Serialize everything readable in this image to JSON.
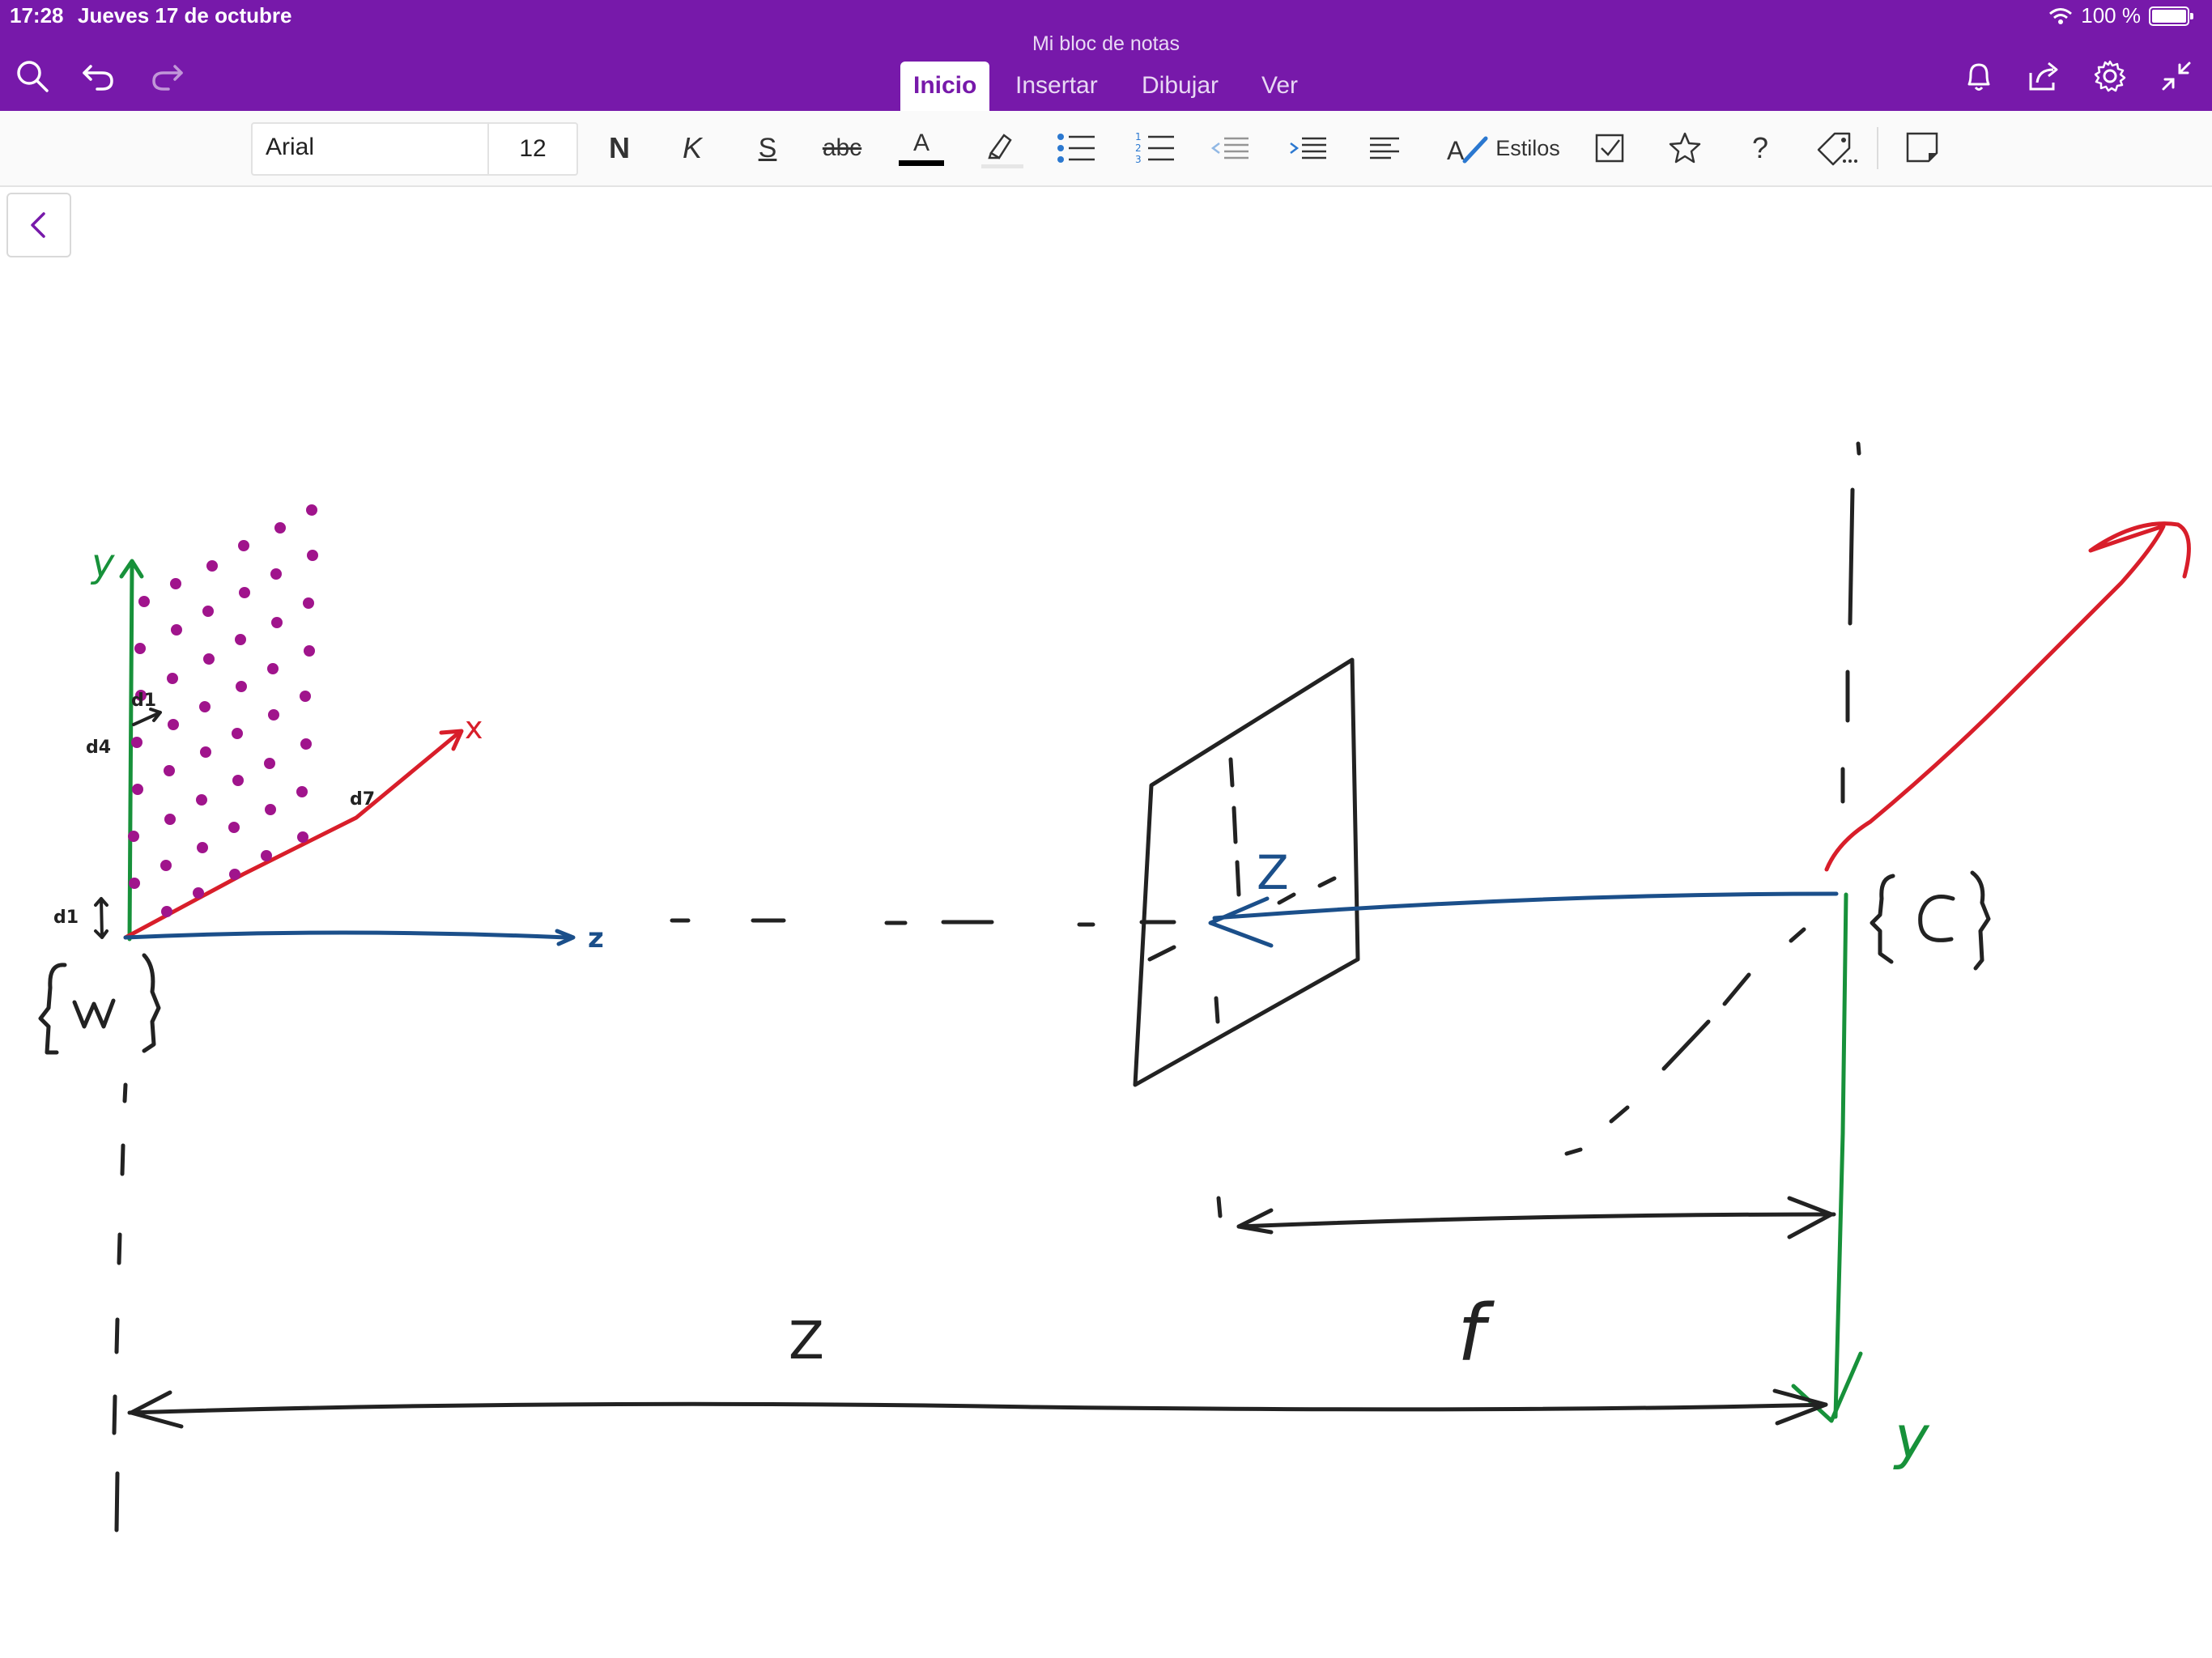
{
  "status": {
    "time": "17:28",
    "date": "Jueves 17 de octubre",
    "battery": "100 %"
  },
  "notebook": {
    "title": "Mi bloc de notas"
  },
  "tabs": [
    {
      "label": "Inicio",
      "active": true
    },
    {
      "label": "Insertar",
      "active": false
    },
    {
      "label": "Dibujar",
      "active": false
    },
    {
      "label": "Ver",
      "active": false
    }
  ],
  "ribbon": {
    "font_name": "Arial",
    "font_size": "12",
    "bold": "N",
    "italic": "K",
    "underline": "S",
    "strike": "abc",
    "font_color_glyph": "A",
    "styles": "Estilos",
    "help": "?"
  },
  "icons": {
    "search": "search-icon",
    "undo": "undo-icon",
    "redo": "redo-icon",
    "bell": "bell-icon",
    "share": "share-icon",
    "settings": "gear-icon",
    "collapse": "collapse-icon",
    "highlighter": "highlighter-icon",
    "bullets": "bullet-list-icon",
    "numbering": "numbered-list-icon",
    "outdent": "outdent-icon",
    "indent": "indent-icon",
    "align": "align-left-icon",
    "checkbox": "todo-checkbox-icon",
    "star": "star-tag-icon",
    "tag": "tag-icon",
    "sticky": "sticky-note-icon",
    "back": "chevron-left-icon"
  },
  "colors": {
    "brand": "#7719aa",
    "ink_black": "#222222",
    "ink_blue": "#1b4f8a",
    "ink_green": "#17913a",
    "ink_red": "#d81e2a",
    "ink_magenta": "#a0148c"
  },
  "sketch": {
    "y_axis_label": "y",
    "x_axis_label": "x",
    "z_axis_label": "z",
    "world_frame": "{W}",
    "camera_frame": "{C}",
    "image_plane_label": "Z",
    "distance_Z": "Z",
    "focal_f": "f",
    "camera_y": "y",
    "d1_top": "d1",
    "d4": "d4",
    "d7": "d7",
    "d1_left": "d1"
  }
}
